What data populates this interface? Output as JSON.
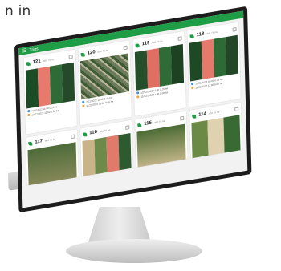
{
  "headline": "n in",
  "app": {
    "menu_icon": "menu-icon",
    "title": "Trips"
  },
  "cards": [
    {
      "num": "121",
      "sub": "ddd 75 ha",
      "line1": "7/21/2022 11:00",
      "line2": "12/22/2022 11:00",
      "val1": "0.25 ha",
      "val2": "0.00 ha"
    },
    {
      "num": "120",
      "sub": "ddd 75 ha",
      "line1": "7/21/2022 11:00",
      "line2": "11/22/2022 11:00",
      "val1": "0.25 ha",
      "val2": "0.00 ha"
    },
    {
      "num": "119",
      "sub": "ddd 75 ha",
      "line1": "12/22/2022 11:00",
      "line2": "11/22/2022 11:00",
      "val1": "0.25 ha",
      "val2": "0.00 ha"
    },
    {
      "num": "118",
      "sub": "ddd 75 ha",
      "line1": "12/21/2022 06:00",
      "line2": "11/22/2022 11:00",
      "val1": "0.25 ha",
      "val2": "0.00 ha"
    },
    {
      "num": "117",
      "sub": "ddd 75 ha"
    },
    {
      "num": "116",
      "sub": "ddd 75 ha"
    },
    {
      "num": "115",
      "sub": "ddd 75 ha"
    },
    {
      "num": "114",
      "sub": "ddd 75 ha"
    }
  ],
  "colors": {
    "brand": "#1f9d46"
  }
}
